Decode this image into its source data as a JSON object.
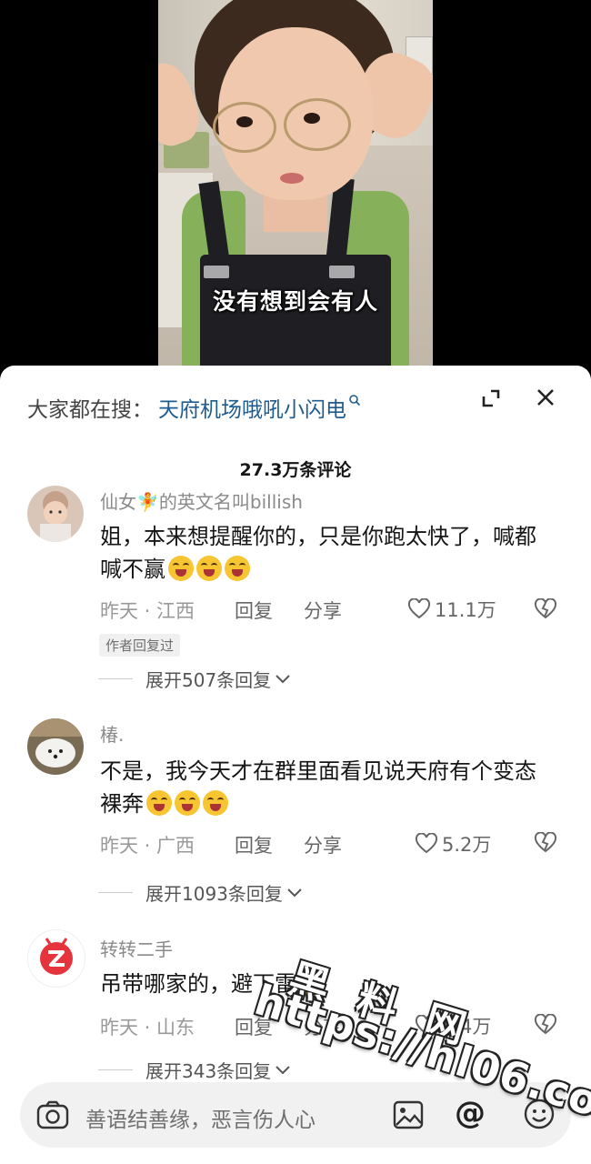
{
  "video": {
    "subtitle": "没有想到会有人"
  },
  "sheet": {
    "search_prefix": "大家都在搜：",
    "search_term": "天府机场哦吼小闪电",
    "comment_count": "27.3万条评论"
  },
  "comments": [
    {
      "name": "仙女🧚的英文名叫billish",
      "text": "姐，本来想提醒你的，只是你跑太快了，喊都喊不赢",
      "emoji_count": 3,
      "time_location": "昨天 · 江西",
      "reply": "回复",
      "share": "分享",
      "likes": "11.1万",
      "badge": "作者回复过",
      "expand": "展开507条回复"
    },
    {
      "name": "椿.",
      "text": "不是，我今天才在群里面看见说天府有个变态裸奔",
      "emoji_count": 3,
      "time_location": "昨天 · 广西",
      "reply": "回复",
      "share": "分享",
      "likes": "5.2万",
      "expand": "展开1093条回复"
    },
    {
      "name": "转转二手",
      "text": "吊带哪家的，避下雷",
      "emoji_count": 1,
      "time_location": "昨天 · 山东",
      "reply": "回复",
      "share": "分享",
      "likes": "2.4万",
      "expand": "展开343条回复"
    }
  ],
  "input": {
    "placeholder": "善语结善缘，恶言伤人心"
  },
  "watermark": {
    "cn": "黑料网",
    "url": "https://hl06.co"
  },
  "colors": {
    "search_link": "#1f5c8f",
    "brand_zhuanzhuan": "#e5343b"
  }
}
